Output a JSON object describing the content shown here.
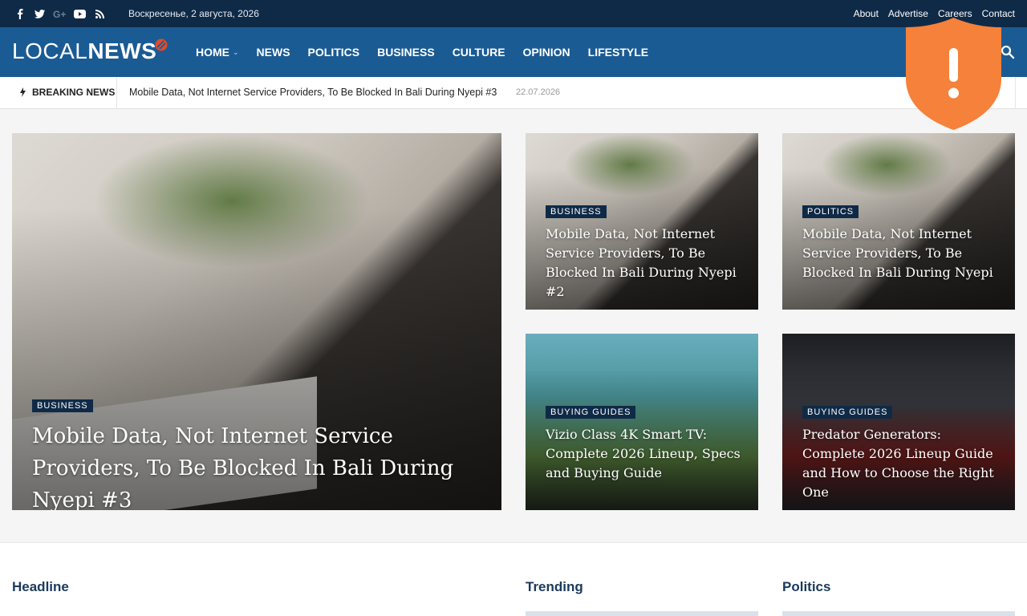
{
  "topbar": {
    "social_icons": [
      "facebook-icon",
      "twitter-icon",
      "google-plus-icon",
      "youtube-icon",
      "rss-icon"
    ],
    "date": "Воскресенье, 2 августа, 2026",
    "links": [
      "About",
      "Advertise",
      "Careers",
      "Contact"
    ]
  },
  "header": {
    "logo_part1": "LOCAL",
    "logo_part2": "NEWS",
    "nav": [
      {
        "label": "HOME",
        "has_caret": true
      },
      {
        "label": "NEWS"
      },
      {
        "label": "POLITICS"
      },
      {
        "label": "BUSINESS"
      },
      {
        "label": "CULTURE"
      },
      {
        "label": "OPINION"
      },
      {
        "label": "LIFESTYLE"
      }
    ]
  },
  "breaking": {
    "label": "BREAKING NEWS",
    "headline": "Mobile Data, Not Internet Service Providers, To Be Blocked In Bali During Nyepi #3",
    "date": "22.07.2026"
  },
  "cards": {
    "main": {
      "category": "BUSINESS",
      "title": "Mobile Data, Not Internet Service Providers, To Be Blocked In Bali During Nyepi #3"
    },
    "top_mid": {
      "category": "BUSINESS",
      "title": "Mobile Data, Not Internet Service Providers, To Be Blocked In Bali During Nyepi #2"
    },
    "top_right": {
      "category": "POLITICS",
      "title": "Mobile Data, Not Internet Service Providers, To Be Blocked In Bali During Nyepi"
    },
    "bottom_mid": {
      "category": "BUYING GUIDES",
      "title": "Vizio Class 4K Smart TV: Complete 2026 Lineup, Specs and Buying Guide"
    },
    "bottom_right": {
      "category": "BUYING GUIDES",
      "title": "Predator Generators: Complete 2026 Lineup Guide and How to Choose the Right One"
    }
  },
  "sections": {
    "headline": "Headline",
    "trending": "Trending",
    "politics": "Politics"
  },
  "colors": {
    "topbar": "#0f2a47",
    "header": "#1a5b94",
    "shield": "#f5813a"
  }
}
